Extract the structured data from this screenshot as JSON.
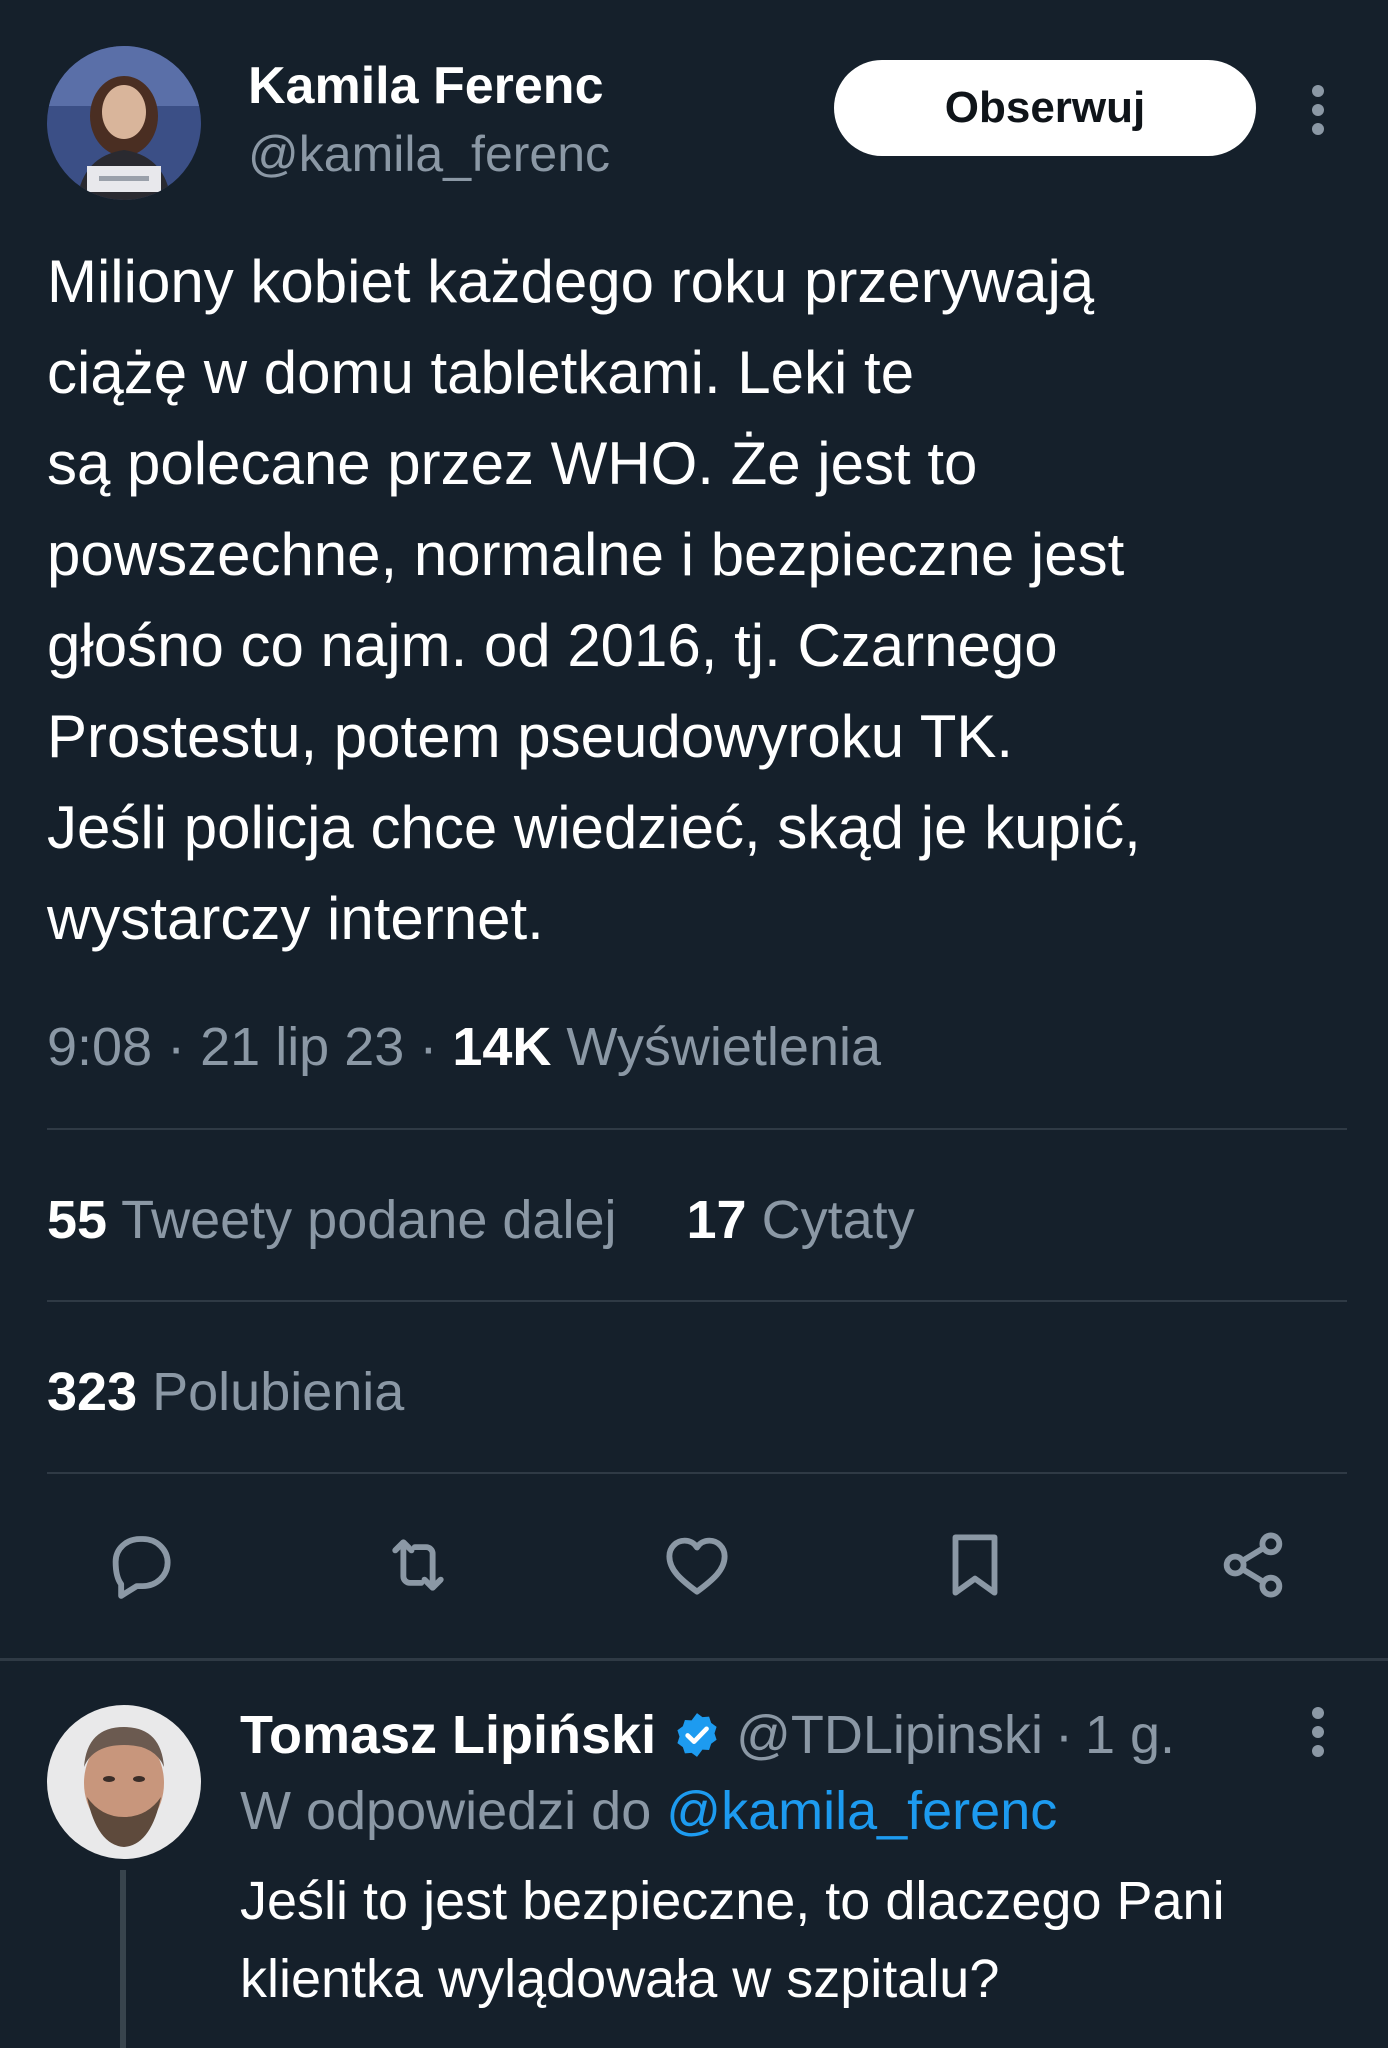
{
  "tweet": {
    "author": {
      "name": "Kamila Ferenc",
      "handle": "@kamila_ferenc",
      "avatar": "portrait-photo"
    },
    "follow_label": "Obserwuj",
    "more_icon": "more-vertical-icon",
    "text": "Miliony kobiet każdego roku przerywają\nciążę w domu tabletkami. Leki te\nsą polecane przez WHO. Że jest to\npowszechne, normalne i bezpieczne jest\ngłośno co najm. od 2016, tj. Czarnego\nProstestu, potem pseudowyroku TK.\nJeśli policja chce wiedzieć, skąd je kupić,\nwystarczy internet.",
    "time": "9:08",
    "date": "21 lip 23",
    "separator": "·",
    "views_count": "14K",
    "views_label": "Wyświetlenia",
    "stats": {
      "retweets_count": "55",
      "retweets_label": "Tweety podane dalej",
      "quotes_count": "17",
      "quotes_label": "Cytaty",
      "likes_count": "323",
      "likes_label": "Polubienia"
    },
    "actions": [
      "reply-icon",
      "retweet-icon",
      "like-icon",
      "bookmark-icon",
      "share-icon"
    ]
  },
  "reply": {
    "author": {
      "name": "Tomasz Lipiński",
      "handle": "@TDLipinski",
      "verified": true,
      "avatar": "portrait-photo"
    },
    "age": "1 g.",
    "separator": "·",
    "reply_to_label": "W odpowiedzi do",
    "reply_to_handle": "@kamila_ferenc",
    "text": "Jeśli to jest bezpieczne, to dlaczego Pani\nklientka wylądowała w szpitalu?"
  },
  "colors": {
    "background": "#15202b",
    "text_primary": "#ffffff",
    "text_secondary": "#8b98a5",
    "accent": "#1d9bf0",
    "divider": "#2f3a45"
  }
}
